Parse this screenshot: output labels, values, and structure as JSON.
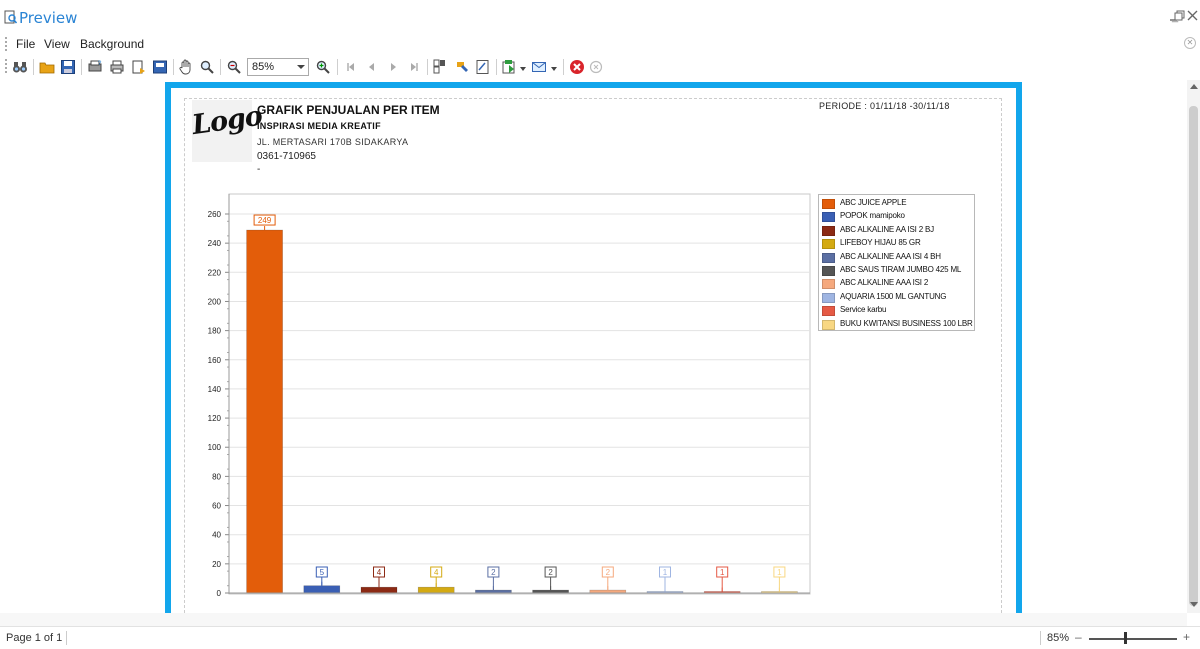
{
  "window": {
    "title": "Preview"
  },
  "menu": {
    "items": [
      "File",
      "View",
      "Background"
    ]
  },
  "toolbar": {
    "zoom_value": "85%",
    "icons": [
      "binoculars-icon",
      "open-icon",
      "save-icon",
      "page-setup-icon",
      "print-icon",
      "quick-print-icon",
      "export-icon",
      "hand-tool-icon",
      "magnifier-icon",
      "zoom-out-icon",
      "zoom-in-icon",
      "first-page-icon",
      "previous-page-icon",
      "next-page-icon",
      "last-page-icon",
      "multiple-pages-icon",
      "color-icon",
      "watermark-icon",
      "export-document-icon",
      "send-email-icon",
      "close-preview-icon",
      "stop-icon"
    ]
  },
  "report": {
    "logo_text": "Logo",
    "title": "GRAFIK PENJUALAN PER ITEM",
    "company": "INSPIRASI MEDIA KREATIF",
    "address": "JL. MERTASARI 170B SIDAKARYA",
    "phone": "0361-710965",
    "extra": "-",
    "period": "PERIODE : 01/11/18 -30/11/18"
  },
  "chart_data": {
    "type": "bar",
    "title": "",
    "xlabel": "",
    "ylabel": "",
    "ylim": [
      0,
      260
    ],
    "yticks": [
      0,
      20,
      40,
      60,
      80,
      100,
      120,
      140,
      160,
      180,
      200,
      220,
      240,
      260
    ],
    "grid": true,
    "legend_position": "right",
    "categories": [
      "ABC JUICE APPLE",
      "POPOK mamipoko",
      "ABC ALKALINE AA ISI 2 BJ",
      "LIFEBOY HIJAU 85 GR",
      "ABC ALKALINE AAA ISI 4 BH",
      "ABC SAUS TIRAM JUMBO 425 ML",
      "ABC ALKALINE AAA ISI 2",
      "AQUARIA 1500 ML GANTUNG",
      "Service karbu",
      "BUKU KWITANSI BUSINESS 100 LBR"
    ],
    "values": [
      249,
      5,
      4,
      4,
      2,
      2,
      2,
      1,
      1,
      1
    ],
    "colors": [
      "#e35d0a",
      "#3a5fb4",
      "#8c2a14",
      "#d4aa12",
      "#5b6fa3",
      "#555555",
      "#f5a97e",
      "#9fb5e2",
      "#e55a45",
      "#f8d782"
    ]
  },
  "status": {
    "page": "Page 1 of 1",
    "zoom": "85%",
    "zoom_minus": "–",
    "zoom_plus": "+"
  }
}
